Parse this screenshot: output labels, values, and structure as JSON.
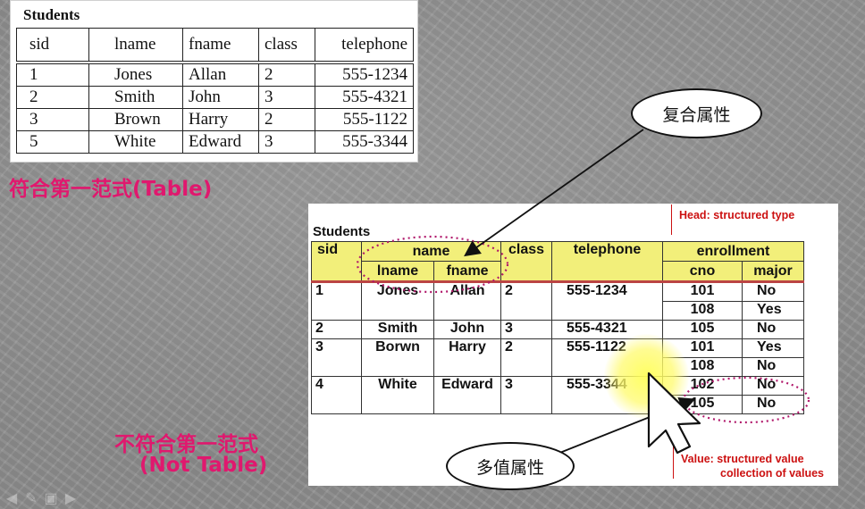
{
  "top_table": {
    "caption": "Students",
    "headers": [
      "sid",
      "lname",
      "fname",
      "class",
      "telephone"
    ],
    "rows": [
      [
        "1",
        "Jones",
        "Allan",
        "2",
        "555-1234"
      ],
      [
        "2",
        "Smith",
        "John",
        "3",
        "555-4321"
      ],
      [
        "3",
        "Brown",
        "Harry",
        "2",
        "555-1122"
      ],
      [
        "5",
        "White",
        "Edward",
        "3",
        "555-3344"
      ]
    ]
  },
  "captions": {
    "conform": "符合第一范式(Table)",
    "not_conform_line1": "不符合第一范式",
    "not_conform_line2": "(Not Table)"
  },
  "bottom_table": {
    "caption": "Students",
    "headers": {
      "sid": "sid",
      "name": "name",
      "lname": "lname",
      "fname": "fname",
      "class": "class",
      "telephone": "telephone",
      "enrollment": "enrollment",
      "cno": "cno",
      "major": "major"
    },
    "rows": [
      {
        "sid": "1",
        "lname": "Jones",
        "fname": "Allan",
        "class": "2",
        "telephone": "555-1234",
        "enrollments": [
          {
            "cno": "101",
            "major": "No"
          },
          {
            "cno": "108",
            "major": "Yes"
          }
        ]
      },
      {
        "sid": "2",
        "lname": "Smith",
        "fname": "John",
        "class": "3",
        "telephone": "555-4321",
        "enrollments": [
          {
            "cno": "105",
            "major": "No"
          }
        ]
      },
      {
        "sid": "3",
        "lname": "Borwn",
        "fname": "Harry",
        "class": "2",
        "telephone": "555-1122",
        "enrollments": [
          {
            "cno": "101",
            "major": "Yes"
          },
          {
            "cno": "108",
            "major": "No"
          }
        ]
      },
      {
        "sid": "4",
        "lname": "White",
        "fname": "Edward",
        "class": "3",
        "telephone": "555-3344",
        "enrollments": [
          {
            "cno": "102",
            "major": "No"
          },
          {
            "cno": "105",
            "major": "No"
          }
        ]
      }
    ]
  },
  "annotations": {
    "head_note": "Head: structured type",
    "value_note_line1": "Value: structured value",
    "value_note_line2": "collection of values",
    "composite_attribute": "复合属性",
    "multivalued_attribute": "多值属性"
  },
  "colors": {
    "caption_pink": "#e0186e",
    "header_yellow": "#f2ef7a",
    "note_red": "#cc1111"
  }
}
